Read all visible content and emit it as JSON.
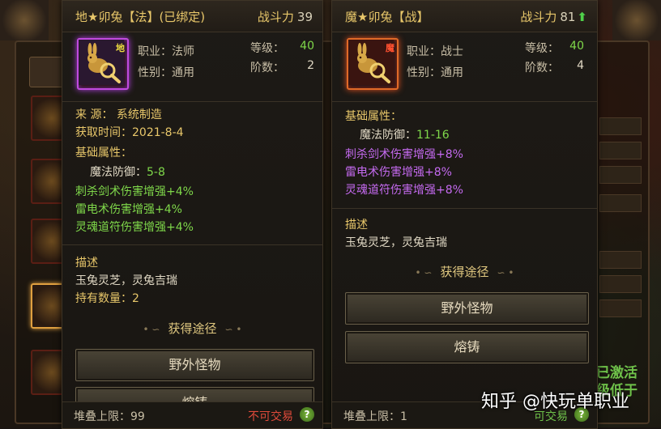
{
  "left_card": {
    "title": "地★卯兔【法】(已绑定)",
    "power_label": "战斗力",
    "power_value": "39",
    "icon_tag": "地",
    "class_label": "职业：法师",
    "gender_label": "性别：通用",
    "level_label": "等级：",
    "level_value": "40",
    "rank_label": "阶数：",
    "rank_value": "2",
    "source": "来      源： 系统制造",
    "obtain_time": "获取时间：2021-8-4",
    "base_attr_title": "基础属性：",
    "magic_def_label": "魔法防御：",
    "magic_def_value": "5-8",
    "bonus_lines": [
      "刺杀剑术伤害增强+4%",
      "雷电术伤害增强+4%",
      "灵魂道符伤害增强+4%"
    ],
    "desc_title": "描述",
    "desc_text": "玉兔灵芝，灵兔吉瑞",
    "hold_count": "持有数量：2",
    "obtain_title": "获得途径",
    "buttons": [
      "野外怪物",
      "熔铸"
    ],
    "stack_limit": "堆叠上限：99",
    "trade_status": "不可交易",
    "help": "?"
  },
  "right_card": {
    "title": "魔★卯兔【战】",
    "power_label": "战斗力",
    "power_value": "81",
    "power_up": "⬆",
    "icon_tag": "魔",
    "class_label": "职业：战士",
    "gender_label": "性别：通用",
    "level_label": "等级：",
    "level_value": "40",
    "rank_label": "阶数：",
    "rank_value": "4",
    "base_attr_title": "基础属性：",
    "magic_def_label": "魔法防御：",
    "magic_def_value": "11-16",
    "bonus_lines": [
      "刺杀剑术伤害增强+8%",
      "雷电术伤害增强+8%",
      "灵魂道符伤害增强+8%"
    ],
    "desc_title": "描述",
    "desc_text": "玉兔灵芝，灵兔吉瑞",
    "obtain_title": "获得途径",
    "buttons": [
      "野外怪物",
      "熔铸"
    ],
    "stack_limit": "堆叠上限：1",
    "trade_status": "可交易",
    "help": "?"
  },
  "background": {
    "green_text": [
      "已激活",
      "级低于"
    ]
  },
  "watermark": "知乎 @快玩单职业",
  "colors": {
    "gold": "#e8c76a",
    "green": "#7fd84a",
    "purple": "#c56af0",
    "red": "#e04a3a",
    "icon_border_left": "#c04adf",
    "icon_border_right": "#e06a28"
  },
  "icons": {
    "left_item": "rabbit-magnifier-icon",
    "right_item": "rabbit-magnifier-icon",
    "help": "question-icon",
    "power_up": "green-up-arrow-icon"
  }
}
